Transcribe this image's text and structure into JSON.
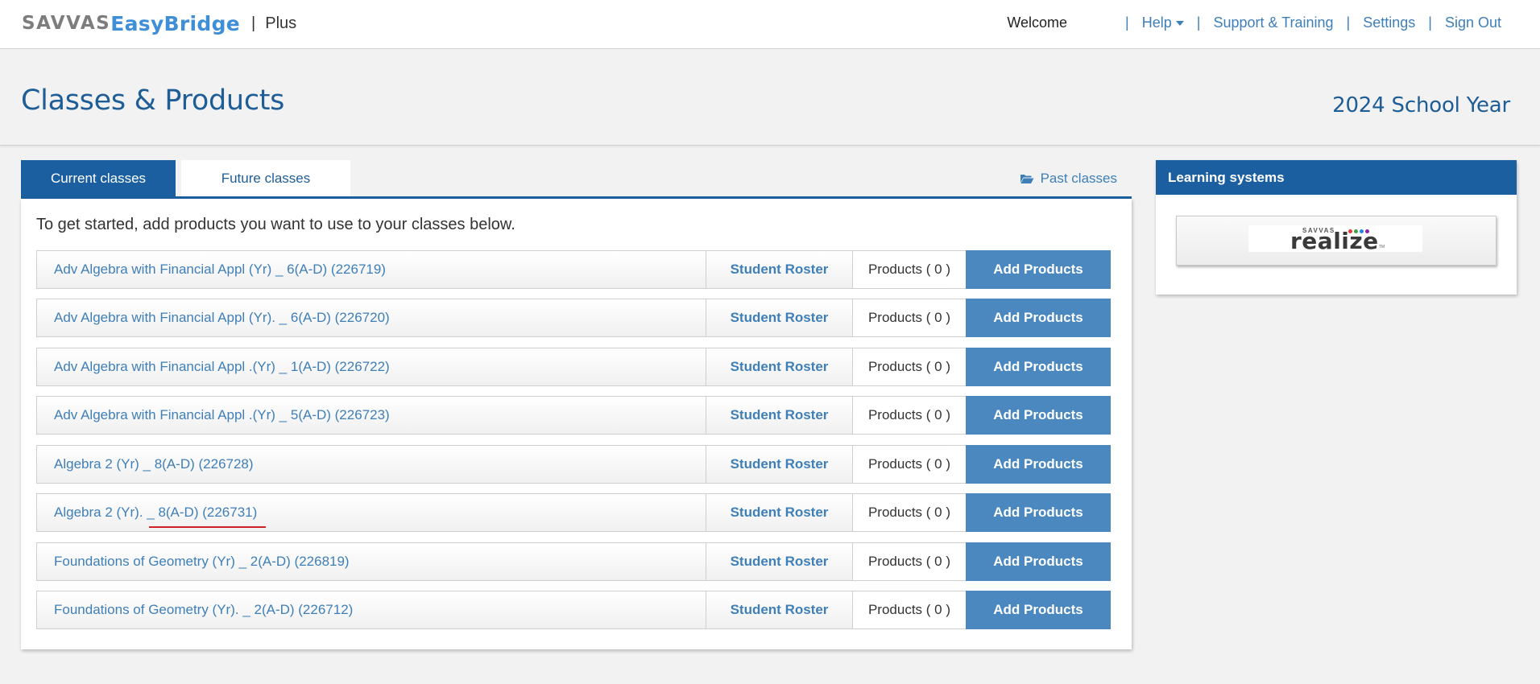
{
  "header": {
    "brand_savvas": "SAVVAS",
    "brand_product": "EasyBridge",
    "brand_separator": "|",
    "brand_plus": "Plus",
    "welcome": "Welcome",
    "separator": "|",
    "nav": {
      "help": "Help",
      "support": "Support & Training",
      "settings": "Settings",
      "signout": "Sign Out"
    }
  },
  "page": {
    "title": "Classes & Products",
    "school_year": "2024 School Year"
  },
  "tabs": {
    "current": "Current classes",
    "future": "Future classes",
    "past": "Past classes"
  },
  "classes": {
    "intro": "To get started, add products you want to use to your classes below.",
    "roster_label": "Student Roster",
    "add_label": "Add Products",
    "rows": [
      {
        "name": "Adv Algebra with Financial Appl (Yr) _ 6(A-D) (226719)",
        "products": "Products ( 0 )"
      },
      {
        "name": "Adv Algebra with Financial Appl (Yr). _ 6(A-D) (226720)",
        "products": "Products ( 0 )"
      },
      {
        "name": "Adv Algebra with Financial Appl .(Yr) _ 1(A-D) (226722)",
        "products": "Products ( 0 )"
      },
      {
        "name": "Adv Algebra with Financial Appl .(Yr) _ 5(A-D) (226723)",
        "products": "Products ( 0 )"
      },
      {
        "name": "Algebra 2 (Yr) _ 8(A-D) (226728)",
        "products": "Products ( 0 )"
      },
      {
        "name": "Algebra 2 (Yr). _ 8(A-D) (226731)",
        "products": "Products ( 0 )"
      },
      {
        "name": "Foundations of Geometry (Yr) _ 2(A-D) (226819)",
        "products": "Products ( 0 )"
      },
      {
        "name": "Foundations of Geometry (Yr). _ 2(A-D) (226712)",
        "products": "Products ( 0 )"
      }
    ]
  },
  "learning_systems": {
    "title": "Learning systems",
    "realize_brand": "SAVVAS",
    "realize_word": "realize",
    "realize_tm": "TM"
  },
  "colors": {
    "primary": "#1b5fa0",
    "link": "#3f7fb8",
    "button": "#4a88bf",
    "annotation_underline": "#d0212a"
  }
}
